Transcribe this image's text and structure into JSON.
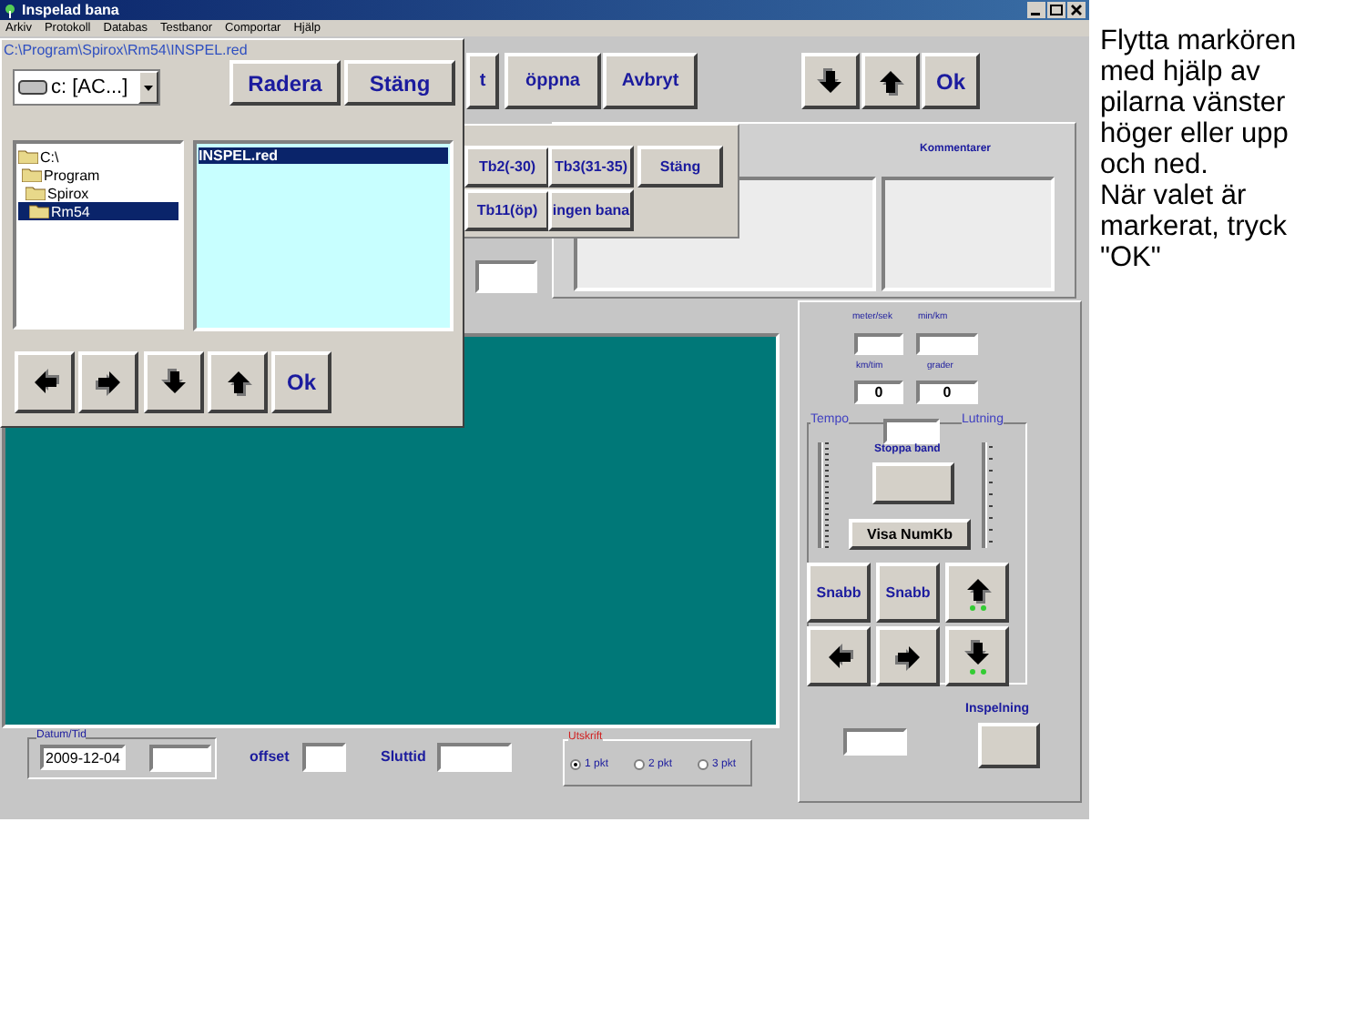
{
  "window": {
    "title": "Inspelad bana"
  },
  "menu": [
    "Arkiv",
    "Protokoll",
    "Databas",
    "Testbanor",
    "Comportar",
    "Hjälp"
  ],
  "toolbar": [
    {
      "kind": "text",
      "label": "t"
    },
    {
      "kind": "text",
      "label": "öppna"
    },
    {
      "kind": "text",
      "label": "Avbryt"
    }
  ],
  "toolbar_nav": [
    {
      "kind": "down"
    },
    {
      "kind": "up"
    },
    {
      "kind": "text",
      "label": "Ok"
    }
  ],
  "track_buttons": [
    "Tb2(-30)",
    "Tb3(31-35)",
    "Stäng",
    "Tb11(öp)",
    "ingen bana"
  ],
  "comments": {
    "label": "Kommentarer"
  },
  "speed": [
    {
      "label": "meter/sek"
    },
    {
      "label": "min/km"
    },
    {
      "label": "km/tim",
      "value": "0"
    },
    {
      "label": "grader",
      "value": "0"
    }
  ],
  "control_group": {
    "left_label": "Tempo",
    "right_label": "Lutning",
    "stop_label": "Stoppa band",
    "numkb_button": "Visa NumKb"
  },
  "pad": [
    {
      "kind": "text",
      "label": "Snabb"
    },
    {
      "kind": "text",
      "label": "Snabb"
    },
    {
      "kind": "up"
    },
    {
      "kind": "left"
    },
    {
      "kind": "right"
    },
    {
      "kind": "down"
    }
  ],
  "recording": {
    "label": "Inspelning"
  },
  "date_group": {
    "title": "Datum/Tid",
    "date": "2009-12-04"
  },
  "offset": {
    "label": "offset"
  },
  "end_time": {
    "label": "Sluttid"
  },
  "print_group": {
    "title": "Utskrift",
    "options": [
      {
        "label": "1 pkt",
        "selected": true
      },
      {
        "label": "2 pkt",
        "selected": false
      },
      {
        "label": "3 pkt",
        "selected": false
      }
    ]
  },
  "dialog": {
    "path": "C:\\Program\\Spirox\\Rm54\\INSPEL.red",
    "drive": "c: [AC...]",
    "buttons": [
      "Radera",
      "Stäng"
    ],
    "tree": [
      {
        "label": "C:\\",
        "selected": false,
        "children": [
          {
            "label": "Program",
            "selected": false,
            "children": [
              {
                "label": "Spirox",
                "selected": false,
                "children": [
                  {
                    "label": "Rm54",
                    "selected": true
                  }
                ]
              }
            ]
          }
        ]
      }
    ],
    "files": [
      {
        "label": "INSPEL.red",
        "selected": true
      }
    ],
    "nav": [
      {
        "kind": "left"
      },
      {
        "kind": "right"
      },
      {
        "kind": "down"
      },
      {
        "kind": "up"
      },
      {
        "kind": "text",
        "label": "Ok"
      }
    ]
  },
  "instructions": [
    "Flytta markören med hjälp av pilarna vänster höger eller upp och ned.",
    "När valet är markerat, tryck \"OK\""
  ]
}
